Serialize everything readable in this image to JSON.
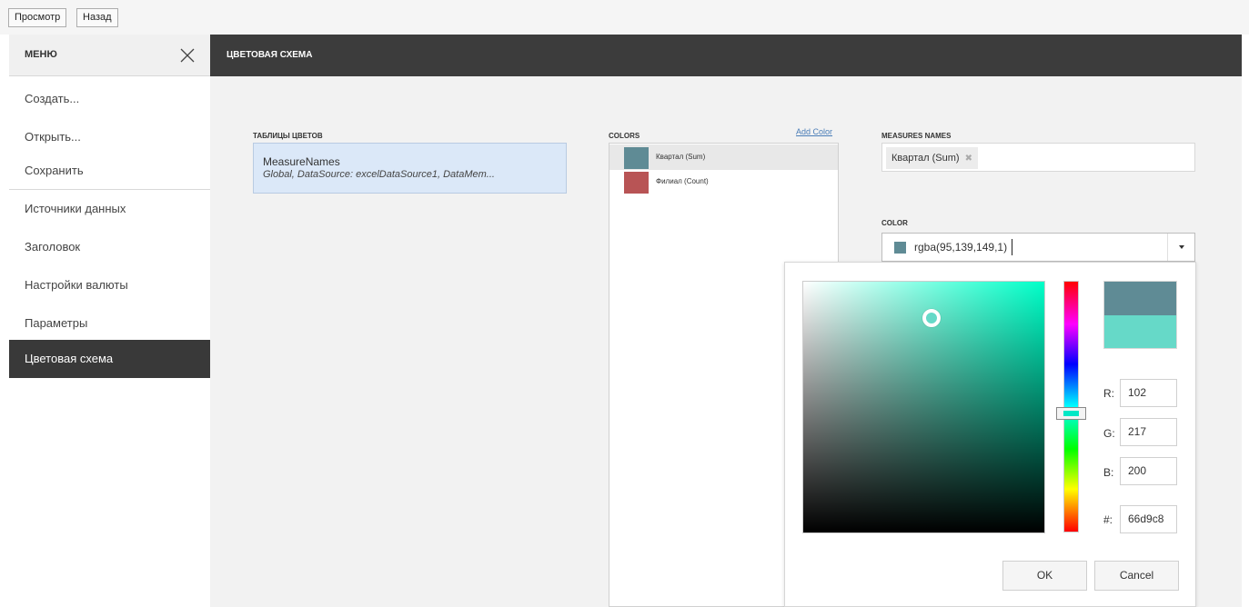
{
  "toolbar": {
    "preview_label": "Просмотр",
    "back_label": "Назад"
  },
  "menu": {
    "title": "МЕНЮ",
    "items": [
      {
        "label": "Создать..."
      },
      {
        "label": "Открыть..."
      },
      {
        "label": "Сохранить"
      },
      {
        "label": "Источники данных"
      },
      {
        "label": "Заголовок"
      },
      {
        "label": "Настройки валюты"
      },
      {
        "label": "Параметры"
      },
      {
        "label": "Цветовая схема",
        "active": true
      }
    ]
  },
  "header": {
    "title": "ЦВЕТОВАЯ СХЕМА"
  },
  "color_tables": {
    "label": "ТАБЛИЦЫ ЦВЕТОВ",
    "item": {
      "name": "MeasureNames",
      "detail": "Global, DataSource: excelDataSource1, DataMem..."
    }
  },
  "colors": {
    "label": "COLORS",
    "add_label": "Add Color",
    "items": [
      {
        "label": "Квартал (Sum)",
        "color": "#5f8b95",
        "selected": true
      },
      {
        "label": "Филиал (Count)",
        "color": "#b85455",
        "selected": false
      }
    ]
  },
  "measures_names": {
    "label": "MEASURES NAMES",
    "tag": "Квартал (Sum)",
    "remove_glyph": "✖"
  },
  "color": {
    "label": "COLOR",
    "value": "rgba(95,139,149,1)",
    "swatch": "#5f8b95"
  },
  "picker": {
    "old_color": "#5f8b95",
    "new_color": "#66d9c8",
    "r_label": "R:",
    "r": "102",
    "g_label": "G:",
    "g": "217",
    "b_label": "B:",
    "b": "200",
    "hex_label": "#:",
    "hex": "66d9c8",
    "ok_label": "OK",
    "cancel_label": "Cancel"
  }
}
